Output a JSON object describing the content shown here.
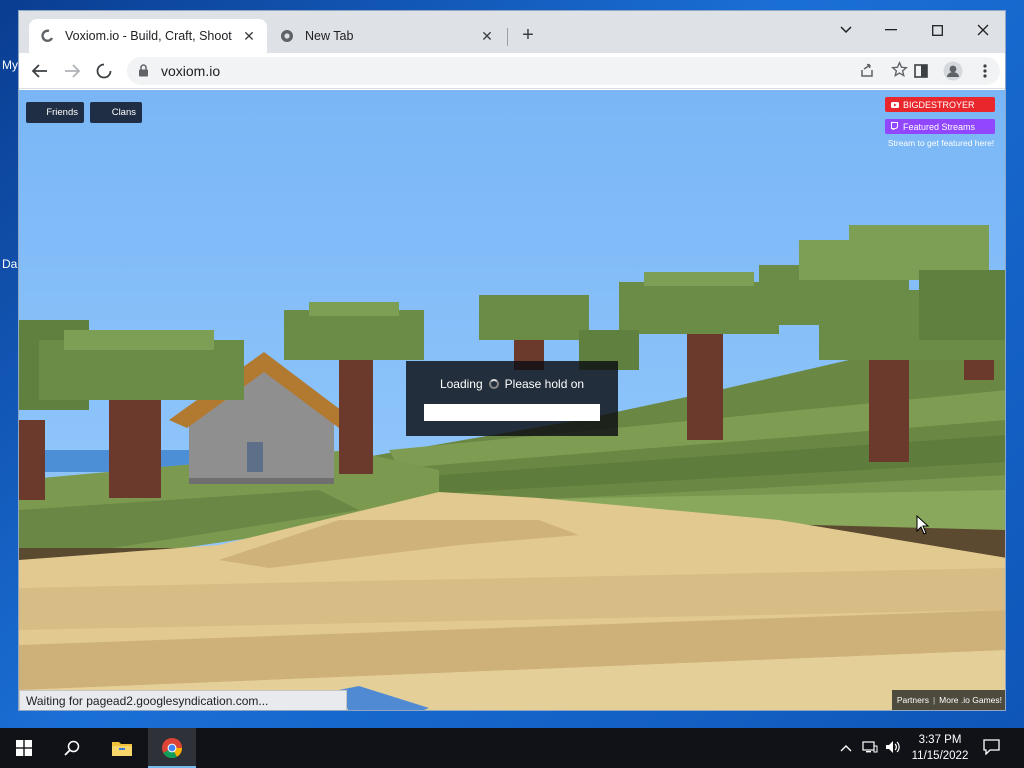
{
  "desktop": {
    "fragments": [
      "My",
      "Da"
    ]
  },
  "browser": {
    "tabs": [
      {
        "title": "Voxiom.io - Build, Craft, Shoot",
        "active": true
      },
      {
        "title": "New Tab",
        "active": false
      }
    ],
    "url": "voxiom.io",
    "status_text": "Waiting for pagead2.googlesyndication.com..."
  },
  "game": {
    "top_left_buttons": [
      {
        "label": "Friends"
      },
      {
        "label": "Clans"
      }
    ],
    "streams": {
      "user": "BIGDESTROYER",
      "featured_label": "Featured Streams",
      "hint": "Stream to get featured here!"
    },
    "loading": {
      "label": "Loading",
      "message": "Please hold on"
    },
    "footer": {
      "partners": "Partners",
      "more_games": "More .io Games!"
    }
  },
  "taskbar": {
    "time": "3:37 PM",
    "date": "11/15/2022"
  },
  "colors": {
    "youtube_red": "#e9262b",
    "twitch_purple": "#9146ff",
    "game_button": "#1f2d45",
    "sky": "#7ab6f6"
  },
  "icons": {
    "start": "windows-logo-icon",
    "search": "search-icon",
    "file_explorer": "folder-icon",
    "chrome": "chrome-icon",
    "reload": "loading-spinner-icon"
  }
}
